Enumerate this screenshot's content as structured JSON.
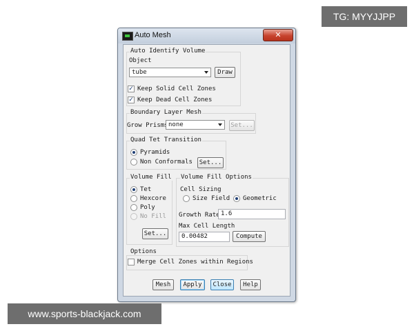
{
  "watermarks": {
    "top_right": "TG: MYYJJPP",
    "bottom_left": "www.sports-blackjack.com"
  },
  "window": {
    "title": "Auto Mesh",
    "close_glyph": "✕"
  },
  "auto_identify": {
    "group_label": "Auto Identify Volume",
    "object_label": "Object",
    "object_value": "tube",
    "draw_button": "Draw",
    "keep_solid_label": "Keep Solid Cell Zones",
    "keep_solid_checked": true,
    "keep_dead_label": "Keep Dead Cell Zones",
    "keep_dead_checked": true,
    "check_glyph": "✓"
  },
  "boundary_layer": {
    "group_label": "Boundary Layer Mesh",
    "grow_prisms_label": "Grow Prisms",
    "grow_prisms_value": "none",
    "set_button": "Set..."
  },
  "quad_tet": {
    "group_label": "Quad Tet Transition",
    "options": [
      "Pyramids",
      "Non Conformals"
    ],
    "selected": "Pyramids",
    "set_button": "Set..."
  },
  "volume_fill": {
    "group_label": "Volume Fill",
    "options": [
      "Tet",
      "Hexcore",
      "Poly",
      "No Fill"
    ],
    "selected": "Tet",
    "disabled": [
      "No Fill"
    ],
    "set_button": "Set..."
  },
  "volume_fill_options": {
    "group_label": "Volume Fill Options",
    "cell_sizing_label": "Cell Sizing",
    "sizing_options": [
      "Size Field",
      "Geometric"
    ],
    "sizing_selected": "Geometric",
    "growth_rate_label": "Growth Rate",
    "growth_rate_value": "1.6",
    "max_cell_length_label": "Max Cell Length",
    "max_cell_length_value": "0.00482",
    "compute_button": "Compute"
  },
  "options": {
    "group_label": "Options",
    "merge_label": "Merge Cell Zones within Regions",
    "merge_checked": false
  },
  "footer": {
    "mesh": "Mesh",
    "apply": "Apply",
    "close": "Close",
    "help": "Help"
  }
}
